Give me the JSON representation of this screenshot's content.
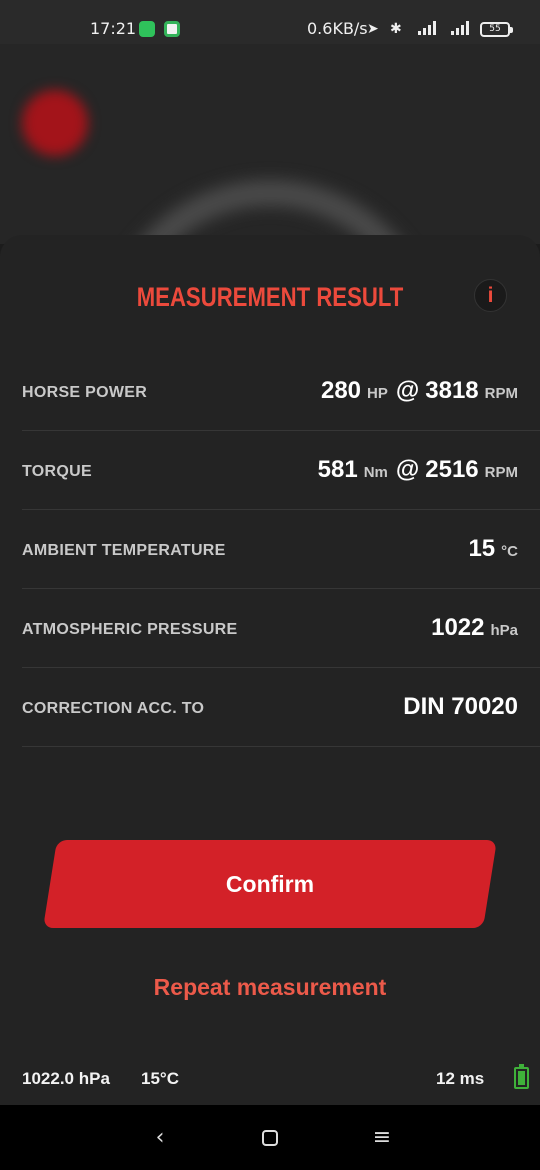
{
  "status_bar": {
    "time": "17:21",
    "network_speed": "0.6KB/s",
    "battery": "55"
  },
  "sheet": {
    "title": "MEASUREMENT RESULT",
    "info_label": "i",
    "rows": [
      {
        "label": "HORSE POWER",
        "value1": "280",
        "unit1": "HP",
        "at": "@",
        "value2": "3818",
        "unit2": "RPM"
      },
      {
        "label": "TORQUE",
        "value1": "581",
        "unit1": "Nm",
        "at": "@",
        "value2": "2516",
        "unit2": "RPM"
      },
      {
        "label": "AMBIENT TEMPERATURE",
        "value1": "15",
        "unit1": "°C"
      },
      {
        "label": "ATMOSPHERIC PRESSURE",
        "value1": "1022",
        "unit1": "hPa"
      },
      {
        "label": "CORRECTION ACC. TO",
        "value1": "DIN 70020"
      }
    ],
    "confirm_label": "Confirm",
    "repeat_label": "Repeat measurement"
  },
  "footer": {
    "pressure": "1022.0 hPa",
    "temperature": "15°C",
    "latency": "12 ms"
  },
  "colors": {
    "accent": "#ec4a3c",
    "button": "#d32128",
    "background": "#232323",
    "battery": "#3fb13a"
  }
}
